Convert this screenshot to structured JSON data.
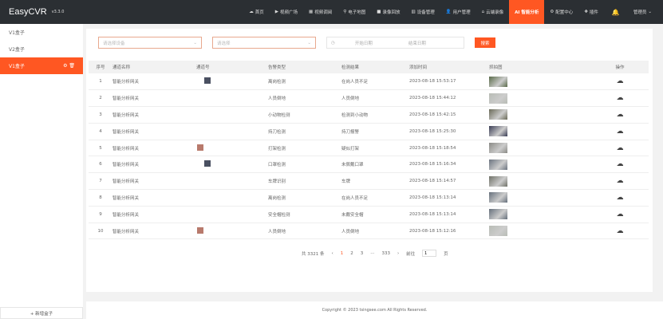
{
  "header": {
    "logo": "EasyCVR",
    "version": "v3.3.0",
    "nav": [
      {
        "label": "首页",
        "icon": "cloud-icon"
      },
      {
        "label": "视频广场",
        "icon": "play-icon"
      },
      {
        "label": "视频调阅",
        "icon": "grid-icon"
      },
      {
        "label": "电子地图",
        "icon": "map-pin-icon"
      },
      {
        "label": "录像回放",
        "icon": "video-icon"
      },
      {
        "label": "设备管理",
        "icon": "device-icon"
      },
      {
        "label": "用户管理",
        "icon": "user-icon"
      },
      {
        "label": "云端录像",
        "icon": "bank-icon"
      },
      {
        "label": "AI 智能分析",
        "icon": "",
        "active": true
      },
      {
        "label": "配置中心",
        "icon": "gear-icon"
      },
      {
        "label": "插件",
        "icon": "puzzle-icon"
      }
    ],
    "user": "管理员"
  },
  "sidebar": {
    "items": [
      {
        "label": "V1盒子"
      },
      {
        "label": "V2盒子"
      },
      {
        "label": "V1盒子",
        "active": true
      }
    ],
    "add_label": "+ 新增盒子"
  },
  "filters": {
    "select1_placeholder": "请选择设备",
    "select2_placeholder": "请选择",
    "start_placeholder": "开始日期",
    "end_placeholder": "结束日期",
    "search_label": "搜索"
  },
  "table": {
    "headers": [
      "序号",
      "通道名称",
      "通道号",
      "告警类型",
      "检测结果",
      "添加时间",
      "抓拍图",
      "操作"
    ],
    "rows": [
      {
        "no": "1",
        "name": "智能分析网关",
        "type": "离岗检测",
        "result": "在岗人员不足",
        "time": "2023-08-18 15:53:17",
        "thumb": "#5a6b4a"
      },
      {
        "no": "2",
        "name": "智能分析网关",
        "type": "人员倒地",
        "result": "人员倒地",
        "time": "2023-08-18 15:44:12",
        "thumb": "#b8bcb5"
      },
      {
        "no": "3",
        "name": "智能分析网关",
        "type": "小动物检测",
        "result": "检测到小动物",
        "time": "2023-08-18 15:42:15",
        "thumb": "#6a6a58"
      },
      {
        "no": "4",
        "name": "智能分析网关",
        "type": "持刀检测",
        "result": "持刀报警",
        "time": "2023-08-18 15:25:30",
        "thumb": "#3a3d55"
      },
      {
        "no": "5",
        "name": "智能分析网关",
        "type": "打架检测",
        "result": "疑似打架",
        "time": "2023-08-18 15:18:54",
        "thumb": "#8a8a86"
      },
      {
        "no": "6",
        "name": "智能分析网关",
        "type": "口罩检测",
        "result": "未佩戴口罩",
        "time": "2023-08-18 15:16:34",
        "thumb": "#6b7480"
      },
      {
        "no": "7",
        "name": "智能分析网关",
        "type": "车牌识别",
        "result": "车牌",
        "time": "2023-08-18 15:14:57",
        "thumb": "#707268"
      },
      {
        "no": "8",
        "name": "智能分析网关",
        "type": "离岗检测",
        "result": "在岗人员不足",
        "time": "2023-08-18 15:13:14",
        "thumb": "#66707c"
      },
      {
        "no": "9",
        "name": "智能分析网关",
        "type": "安全帽检测",
        "result": "未戴安全帽",
        "time": "2023-08-18 15:13:14",
        "thumb": "#66707c"
      },
      {
        "no": "10",
        "name": "智能分析网关",
        "type": "人员倒地",
        "result": "人员倒地",
        "time": "2023-08-18 15:12:16",
        "thumb": "#b8bcb5"
      }
    ],
    "markers": [
      "#4a5061",
      "",
      "",
      "",
      "#b87a6c",
      "#4a5061",
      "",
      "",
      "",
      "#b87a6c"
    ]
  },
  "pagination": {
    "total": "共 3321 条",
    "pages": [
      "1",
      "2",
      "3",
      "···",
      "333"
    ],
    "goto": "前往",
    "page_value": "1",
    "unit": "页"
  },
  "footer": {
    "copyright": "Copyright © 2023 tsingsee.com All Rights Reserved."
  },
  "colors": {
    "accent": "#ff5722",
    "header_bg": "#2b2f33"
  }
}
